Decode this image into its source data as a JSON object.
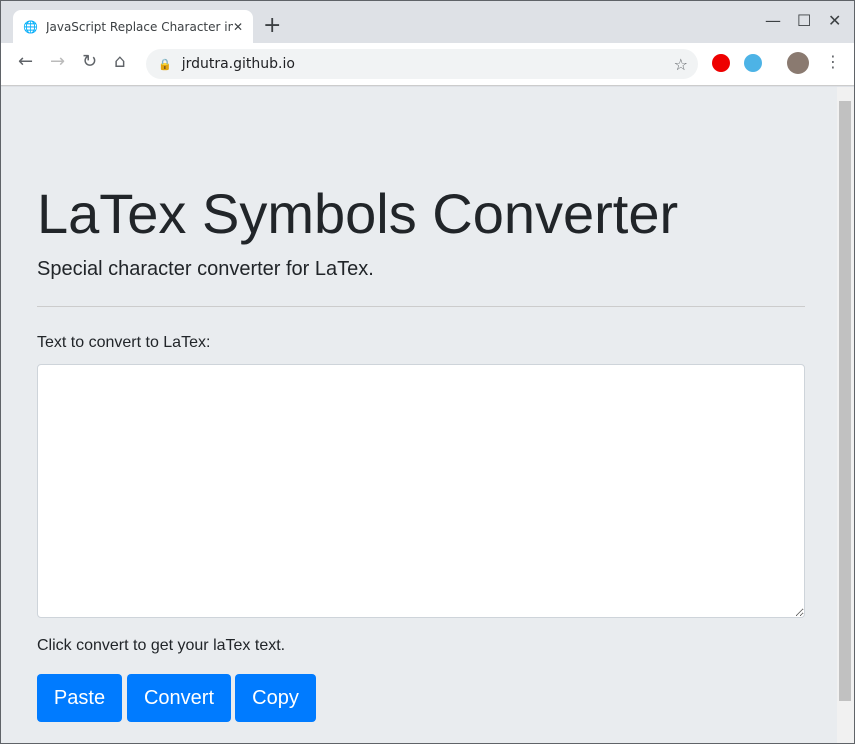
{
  "browser": {
    "tab_title": "JavaScript Replace Character in",
    "url": "jrdutra.github.io"
  },
  "page": {
    "title": "LaTex Symbols Converter",
    "lead": "Special character converter for LaTex.",
    "input_label": "Text to convert to LaTex:",
    "input_value": "",
    "output_label": "Click convert to get your laTex text.",
    "buttons": {
      "paste": "Paste",
      "convert": "Convert",
      "copy": "Copy"
    },
    "button_color": "#007bff"
  }
}
